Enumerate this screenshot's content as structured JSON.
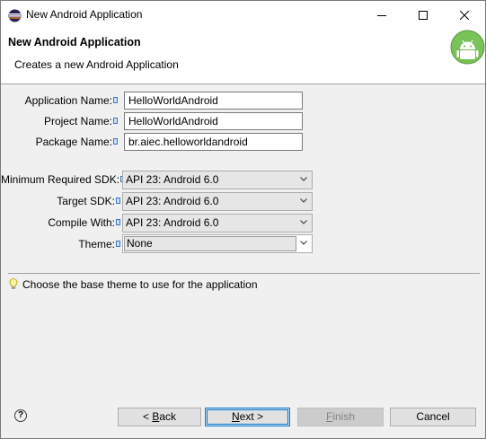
{
  "window": {
    "title": "New Android Application",
    "app_icon": "eclipse-icon",
    "controls": {
      "minimize": "minimize-icon",
      "maximize": "maximize-icon",
      "close": "close-icon"
    }
  },
  "header": {
    "title": "New Android Application",
    "description": "Creates a new Android Application",
    "logo": "android-logo-icon"
  },
  "form": {
    "application_name": {
      "label": "Application Name:",
      "value": "HelloWorldAndroid"
    },
    "project_name": {
      "label": "Project Name:",
      "value": "HelloWorldAndroid"
    },
    "package_name": {
      "label": "Package Name:",
      "value": "br.aiec.helloworldandroid"
    },
    "min_sdk": {
      "label": "Minimum Required SDK:",
      "value": "API 23: Android 6.0"
    },
    "target_sdk": {
      "label": "Target SDK:",
      "value": "API 23: Android 6.0"
    },
    "compile_with": {
      "label": "Compile With:",
      "value": "API 23: Android 6.0"
    },
    "theme": {
      "label": "Theme:",
      "value": "None"
    }
  },
  "hint": {
    "icon": "lightbulb-icon",
    "text": "Choose the base theme to use for the application"
  },
  "footer": {
    "help_icon": "help-icon",
    "back_prefix": "< ",
    "back_mnemonic": "B",
    "back_suffix": "ack",
    "next_mnemonic": "N",
    "next_suffix": "ext >",
    "finish_mnemonic": "F",
    "finish_suffix": "inish",
    "cancel_label": "Cancel"
  },
  "colors": {
    "focus_blue": "#0078d7",
    "android_green": "#78c257",
    "panel": "#f0f0f0"
  }
}
